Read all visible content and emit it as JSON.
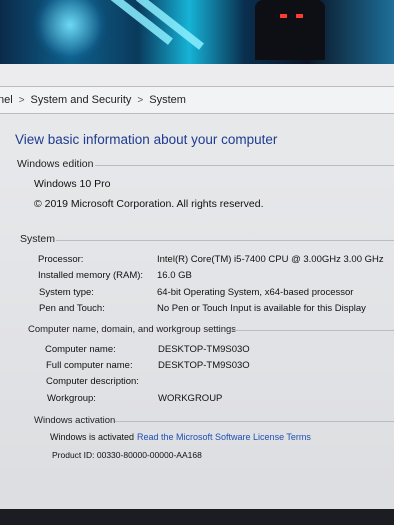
{
  "breadcrumb": {
    "items": [
      "nel",
      "System and Security",
      "System"
    ],
    "separator": ">"
  },
  "heading": "View basic information about your computer",
  "windows_edition": {
    "title": "Windows edition",
    "edition": "Windows 10 Pro",
    "copyright": "© 2019 Microsoft Corporation. All rights reserved."
  },
  "system": {
    "title": "System",
    "rows": [
      {
        "label": "Processor:",
        "value": "Intel(R) Core(TM) i5-7400 CPU @ 3.00GHz   3.00 GHz"
      },
      {
        "label": "Installed memory (RAM):",
        "value": "16.0 GB"
      },
      {
        "label": "System type:",
        "value": "64-bit Operating System, x64-based processor"
      },
      {
        "label": "Pen and Touch:",
        "value": "No Pen or Touch Input is available for this Display"
      }
    ]
  },
  "computer_name": {
    "title": "Computer name, domain, and workgroup settings",
    "rows": [
      {
        "label": "Computer name:",
        "value": "DESKTOP-TM9S03O"
      },
      {
        "label": "Full computer name:",
        "value": "DESKTOP-TM9S03O"
      },
      {
        "label": "Computer description:",
        "value": ""
      },
      {
        "label": "Workgroup:",
        "value": "WORKGROUP"
      }
    ]
  },
  "activation": {
    "title": "Windows activation",
    "status": "Windows is activated",
    "license_link": "Read the Microsoft Software License Terms",
    "product_id": "Product ID: 00330-80000-00000-AA168"
  },
  "colors": {
    "heading": "#1f3b8f",
    "link": "#1f4fb5",
    "background": "#e6e7ea"
  }
}
